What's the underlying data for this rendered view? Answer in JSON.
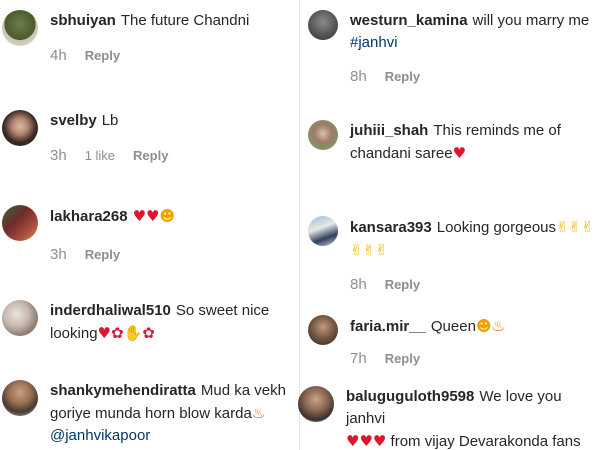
{
  "left": [
    {
      "user": "sbhuiyan",
      "text": "The future Chandni",
      "time": "4h",
      "likes": "",
      "reply": "Reply"
    },
    {
      "user": "svelby",
      "text": "Lb",
      "time": "3h",
      "likes": "1 like",
      "reply": "Reply"
    },
    {
      "user": "lakhara268",
      "text": "",
      "time": "3h",
      "likes": "",
      "reply": "Reply"
    },
    {
      "user": "inderdhaliwal510",
      "text": "So sweet nice looking",
      "time": "",
      "likes": "",
      "reply": ""
    },
    {
      "user": "shankymehendiratta",
      "text": "Mud ka vekh goriye munda horn blow karda",
      "mention": "@janhvikapoor",
      "time": "",
      "likes": "",
      "reply": ""
    }
  ],
  "right": [
    {
      "user": "westurn_kamina",
      "text": "will you marry me",
      "mention": "#janhvi",
      "time": "8h",
      "likes": "",
      "reply": "Reply"
    },
    {
      "user": "juhiii_shah",
      "text": "This reminds me of chandani saree",
      "time": "",
      "likes": "",
      "reply": ""
    },
    {
      "user": "kansara393",
      "text": "Looking gorgeous",
      "time": "8h",
      "likes": "",
      "reply": "Reply"
    },
    {
      "user": "faria.mir__",
      "text": "Queen",
      "time": "7h",
      "likes": "",
      "reply": "Reply"
    },
    {
      "user": "baluguguloth9598",
      "text": "We love you janhvi",
      "text2": "from vijay Devarakonda fans",
      "time": "",
      "likes": "",
      "reply": ""
    }
  ],
  "colors": {
    "username": "#262626",
    "meta": "#8e8e8e",
    "mention": "#00376b",
    "heart": "#e0142c"
  },
  "icons": {
    "heart": "red-heart-emoji",
    "ok": "ok-hand-emoji",
    "pray": "folded-hands-emoji",
    "rose": "rose-emoji",
    "fire": "fire-emoji",
    "starry": "heart-eyes-emoji",
    "wink": "winking-face-emoji"
  }
}
